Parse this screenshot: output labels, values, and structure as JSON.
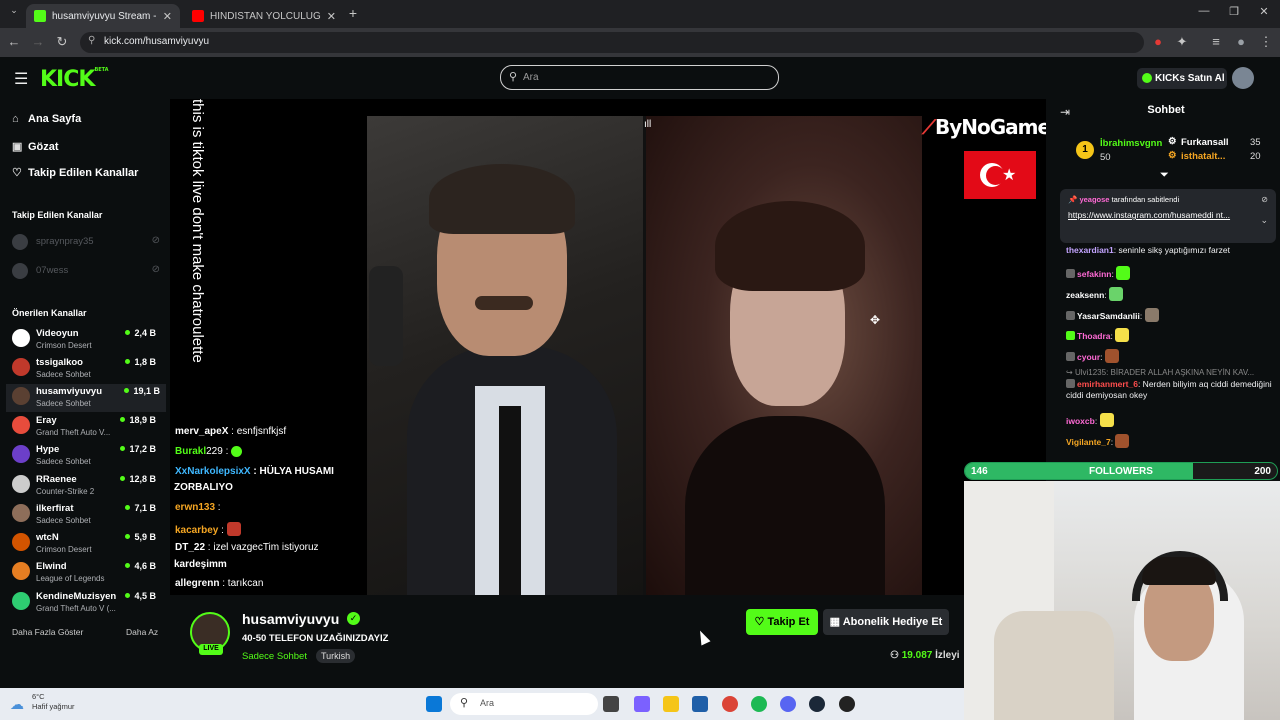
{
  "browser": {
    "tabs": [
      {
        "title": "husamviyuvyu Stream - Wa",
        "active": true,
        "fav_color": "#53fc18"
      },
      {
        "title": "HİNDİSTAN YOLCULUĞU VE Hİ",
        "active": false,
        "fav_color": "#ff0000"
      }
    ],
    "url": "kick.com/husamviyuvyu"
  },
  "header": {
    "logo": "KICK",
    "logo_sup": "BETA",
    "search_placeholder": "Ara",
    "kicks_label": "KICKs Satın Al"
  },
  "nav": {
    "items": [
      {
        "label": "Ana Sayfa",
        "icon": "home-icon",
        "glyph": "⌂"
      },
      {
        "label": "Gözat",
        "icon": "browse-icon",
        "glyph": "▣"
      },
      {
        "label": "Takip Edilen Kanallar",
        "icon": "heart-icon",
        "glyph": "♡"
      }
    ],
    "followed_heading": "Takip Edilen Kanallar",
    "followed": [
      {
        "name": "spraynpray35"
      },
      {
        "name": "07wess"
      }
    ],
    "recommended_heading": "Önerilen Kanallar",
    "recommended": [
      {
        "name": "Videoyun",
        "category": "Crimson Desert",
        "viewers": "2,4 B",
        "color": "#ffffff"
      },
      {
        "name": "tssigalkoo",
        "category": "Sadece Sohbet",
        "viewers": "1,8 B",
        "color": "#c0392b"
      },
      {
        "name": "husamviyuvyu",
        "category": "Sadece Sohbet",
        "viewers": "19,1 B",
        "color": "#5a4032"
      },
      {
        "name": "Eray",
        "category": "Grand Theft Auto V...",
        "viewers": "18,9 B",
        "color": "#e74c3c"
      },
      {
        "name": "Hype",
        "category": "Sadece Sohbet",
        "viewers": "17,2 B",
        "color": "#6c3fc9"
      },
      {
        "name": "RRaenee",
        "category": "Counter-Strike 2",
        "viewers": "12,8 B",
        "color": "#cccccc"
      },
      {
        "name": "ilkerfirat",
        "category": "Sadece Sohbet",
        "viewers": "7,1 B",
        "color": "#8e6e5a"
      },
      {
        "name": "wtcN",
        "category": "Crimson Desert",
        "viewers": "5,9 B",
        "color": "#d35400"
      },
      {
        "name": "Elwind",
        "category": "League of Legends",
        "viewers": "4,6 B",
        "color": "#e67e22"
      },
      {
        "name": "KendineMuzisyen",
        "category": "Grand Theft Auto V (...",
        "viewers": "4,5 B",
        "color": "#2ecc71"
      }
    ],
    "show_more": "Daha Fazla Göster",
    "show_less": "Daha Az"
  },
  "stream_overlay": {
    "vertical_text": "this is tiktok live don't make chatroulette",
    "brand": "ByNoGame",
    "chat": [
      {
        "user": "merv_apeX",
        "msg": " : esnfjsnfkjsf",
        "color": "#ffffff"
      },
      {
        "user": "Burakl",
        "msg": "229 :",
        "color": "#53fc18"
      },
      {
        "user": "XxNarkolepsixX",
        "msg": " : HÜLYA HUSAMI",
        "color": "#3fb8ff"
      },
      {
        "user": "",
        "msg": "ZORBALIYO",
        "color": "#ffffff"
      },
      {
        "user": "erwn133",
        "msg": " :",
        "color": "#f5a623"
      },
      {
        "user": "kacarbey",
        "msg": " :",
        "color": "#f5a623"
      },
      {
        "user": "DT_22",
        "msg": " : izel vazgecTim istiyoruz",
        "color": "#ffffff"
      },
      {
        "user": "",
        "msg": "kardeşimm",
        "color": "#ffffff"
      },
      {
        "user": "allegrenn",
        "msg": " : tarıkcan",
        "color": "#ffffff"
      }
    ]
  },
  "chat": {
    "title": "Sohbet",
    "gifters": [
      {
        "rank": "1",
        "name": "İbrahimsvgnn",
        "count": "50",
        "color": "#53fc18"
      },
      {
        "rank": "",
        "name": "Furkansall",
        "count": "35",
        "color": "#ffffff"
      },
      {
        "rank": "",
        "name": "isthatalt...",
        "count": "20",
        "color": "#f5a623"
      }
    ],
    "pinned_by": "tarafından sabitlendi",
    "pinned_user": "yeagose",
    "pinned_link": "https://www.instagram.com/husameddi nt...",
    "messages": [
      {
        "user": "thexardian1",
        "msg": ": seninle sikş yaptığımızı farzet",
        "color": "#c3a4ff"
      },
      {
        "user": "sefakinn",
        "msg": ":",
        "color": "#ff6ad5"
      },
      {
        "user": "zeaksenn",
        "msg": ":",
        "color": "#ffffff"
      },
      {
        "user": "YasarSamdanlii",
        "msg": ":",
        "color": "#ffffff"
      },
      {
        "user": "Thoadra",
        "msg": ":",
        "color": "#ff6ad5"
      },
      {
        "user": "cyour",
        "msg": ":",
        "color": "#ff6ad5"
      },
      {
        "user": "Ulvi1235",
        "msg": ": BİRADER ALLAH AŞKINA NEYİN KAV...",
        "color": "#888888"
      },
      {
        "user": "emirhanmert_6",
        "msg": ": Nerden biliyim aq ciddi demediğini ciddi demiyosan okey",
        "color": "#ff4d4d"
      },
      {
        "user": "iwoxcb",
        "msg": ":",
        "color": "#ff6ad5"
      },
      {
        "user": "Vigilante_7",
        "msg": ":",
        "color": "#f5a623"
      }
    ]
  },
  "followers_goal": {
    "label": "FOLLOWERS",
    "current": "146",
    "target": "200",
    "fraction": 0.73
  },
  "stream_info": {
    "streamer": "husamviyuvyu",
    "live": "LIVE",
    "title": "40-50 TELEFON UZAĞINIZDAYIZ",
    "category": "Sadece Sohbet",
    "language": "Turkish",
    "follow_label": "Takip Et",
    "gift_label": "Abonelik Hediye Et",
    "viewers": "19.087",
    "viewers_label": "İzleyi"
  },
  "taskbar": {
    "temp": "6°C",
    "weather": "Hafif yağmur",
    "search": "Ara"
  }
}
